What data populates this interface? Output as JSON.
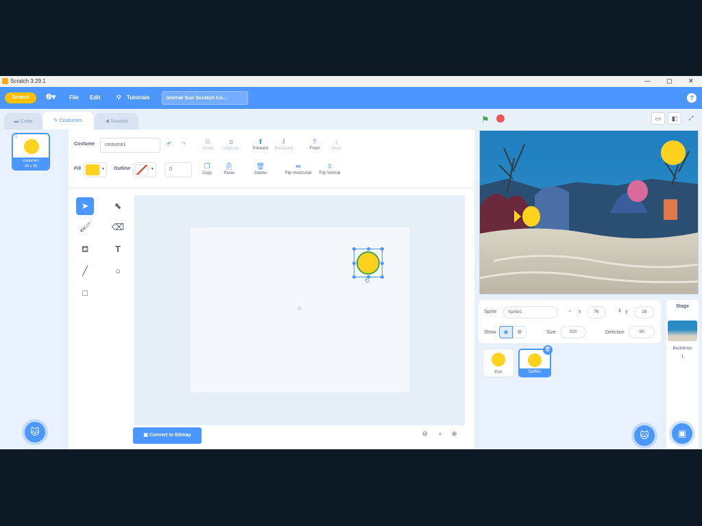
{
  "window": {
    "title": "Scratch 3.29.1",
    "controls": [
      "—",
      "▢",
      "✕"
    ]
  },
  "menubar": {
    "logo": "Scratch",
    "items": [
      {
        "label": "File"
      },
      {
        "label": "Edit"
      },
      {
        "label": "Tutorials"
      }
    ],
    "project_title": "Animal Sun Scratch Co..."
  },
  "tabs": [
    {
      "label": "Code"
    },
    {
      "label": "Costumes"
    },
    {
      "label": "Sounds"
    }
  ],
  "costumes": [
    {
      "num": "1",
      "name": "costume1",
      "size": "39 x 39"
    }
  ],
  "editor": {
    "costume_label": "Costume",
    "costume_name": "costume1",
    "fill_label": "Fill",
    "outline_label": "Outline",
    "outline_width": "0",
    "fill_color": "#ffd21f",
    "group_tools": [
      {
        "label": "Group",
        "disabled": true
      },
      {
        "label": "Ungroup",
        "disabled": true
      },
      {
        "label": "Forward",
        "disabled": false
      },
      {
        "label": "Backward",
        "disabled": true
      },
      {
        "label": "Front",
        "disabled": false
      },
      {
        "label": "Back",
        "disabled": true
      }
    ],
    "edit_tools": [
      {
        "label": "Copy"
      },
      {
        "label": "Paste"
      },
      {
        "label": "Delete"
      },
      {
        "label": "Flip Horizontal"
      },
      {
        "label": "Flip Vertical"
      }
    ],
    "convert_label": "Convert to Bitmap",
    "zoom_reset": "="
  },
  "sprite_info": {
    "sprite_label": "Sprite",
    "sprite_name": "Sprite1",
    "x_label": "x",
    "x_value": "76",
    "y_label": "y",
    "y_value": "28",
    "show_label": "Show",
    "size_label": "Size",
    "size_value": "100",
    "direction_label": "Direction",
    "direction_value": "90"
  },
  "sprites": [
    {
      "name": "Fish",
      "selected": false
    },
    {
      "name": "Sprite1",
      "selected": true
    }
  ],
  "stage_panel": {
    "title": "Stage",
    "backdrops_label": "Backdrops",
    "backdrops_count": "1"
  },
  "colors": {
    "accent": "#4c97ff",
    "sun": "#ffd21f",
    "green_flag": "#3ea44f",
    "stop": "#ec5959"
  }
}
